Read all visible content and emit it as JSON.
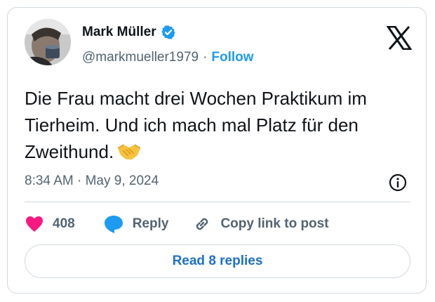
{
  "author": {
    "name": "Mark Müller",
    "handle": "@markmueller1979",
    "separator": "·",
    "follow_label": "Follow"
  },
  "post": {
    "text": "Die Frau macht drei Wochen Praktikum im Tierheim. Und ich mach mal Platz für den Zweithund.",
    "emoji": "handshake",
    "time": "8:34 AM",
    "date": "May 9, 2024",
    "time_separator": "·"
  },
  "actions": {
    "like_count": "408",
    "reply_label": "Reply",
    "copy_label": "Copy link to post"
  },
  "footer": {
    "read_replies_label": "Read 8 replies"
  },
  "colors": {
    "accent": "#1d9bf0",
    "like": "#f91880",
    "text": "#0f1419",
    "muted": "#536471",
    "border": "#cfd9de"
  },
  "icons": [
    "verified-badge-icon",
    "x-logo-icon",
    "handshake-emoji",
    "info-icon",
    "heart-icon",
    "reply-bubble-icon",
    "link-icon"
  ]
}
